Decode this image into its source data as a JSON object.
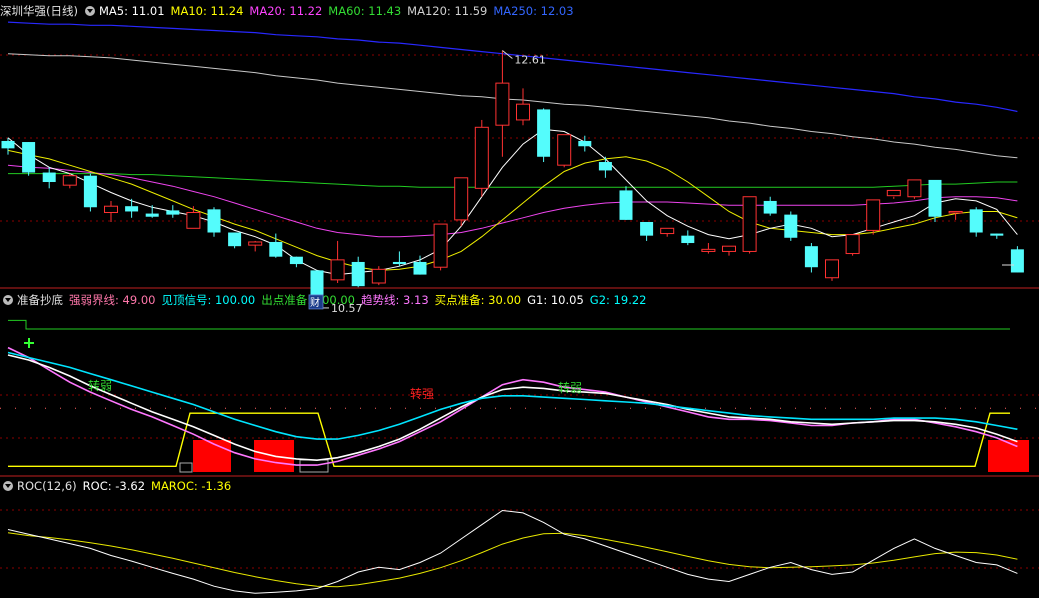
{
  "header1": {
    "title": "深圳华强(日线)",
    "items": [
      {
        "label": "MA5: 11.01",
        "color": "#ffffff"
      },
      {
        "label": "MA10: 11.24",
        "color": "#ffff00"
      },
      {
        "label": "MA20: 11.22",
        "color": "#ff44ff"
      },
      {
        "label": "MA60: 11.43",
        "color": "#33dd33"
      },
      {
        "label": "MA120: 11.59",
        "color": "#d0d0d0"
      },
      {
        "label": "MA250: 12.03",
        "color": "#3366ff"
      }
    ]
  },
  "header2": {
    "title": "准备抄底",
    "items": [
      {
        "label": "强弱界线: 49.00",
        "color": "#ff77aa"
      },
      {
        "label": "见顶信号: 100.00",
        "color": "#00ffff"
      },
      {
        "label": "出点准备: 100.00",
        "color": "#33dd33"
      },
      {
        "label": "趋势线: 3.13",
        "color": "#ff77ff"
      },
      {
        "label": "买点准备: 30.00",
        "color": "#ffff00"
      },
      {
        "label": "G1: 10.05",
        "color": "#ffffff"
      },
      {
        "label": "G2: 19.22",
        "color": "#00ffff"
      }
    ]
  },
  "header3": {
    "title": "ROC(12,6)",
    "items": [
      {
        "label": "ROC: -3.62",
        "color": "#ffffff"
      },
      {
        "label": "MAROC: -1.36",
        "color": "#ffff00"
      }
    ]
  },
  "annotations": {
    "high": "12.61",
    "low": "10.57",
    "cai": "财",
    "weak1": "转弱",
    "strong": "转强",
    "weak2": "转弱"
  },
  "colors": {
    "up": "#ff3232",
    "down": "#54fcfc",
    "bg": "#000000",
    "grid": "#8b0000"
  },
  "chart_data": [
    {
      "type": "candlestick",
      "title": "深圳华强(日线)",
      "ylim": [
        10.4,
        12.9
      ],
      "candles": [
        [
          11.75,
          11.78,
          11.68,
          11.62
        ],
        [
          11.74,
          11.74,
          11.45,
          11.42
        ],
        [
          11.45,
          11.5,
          11.36,
          11.3
        ],
        [
          11.33,
          11.44,
          11.42,
          11.3
        ],
        [
          11.42,
          11.44,
          11.12,
          11.08
        ],
        [
          11.07,
          11.18,
          11.13,
          10.98
        ],
        [
          11.13,
          11.2,
          11.08,
          11.02
        ],
        [
          11.06,
          11.14,
          11.03,
          11.02
        ],
        [
          11.09,
          11.14,
          11.05,
          11.02
        ],
        [
          10.92,
          11.13,
          11.07,
          10.92
        ],
        [
          11.1,
          11.12,
          10.88,
          10.84
        ],
        [
          10.88,
          10.88,
          10.75,
          10.73
        ],
        [
          10.76,
          10.8,
          10.79,
          10.7
        ],
        [
          10.79,
          10.87,
          10.65,
          10.64
        ],
        [
          10.65,
          10.65,
          10.58,
          10.55
        ],
        [
          10.52,
          10.52,
          10.26,
          10.22
        ],
        [
          10.43,
          10.8,
          10.62,
          10.4
        ],
        [
          10.6,
          10.65,
          10.37,
          10.36
        ],
        [
          10.4,
          10.56,
          10.53,
          10.38
        ],
        [
          10.6,
          10.7,
          10.58,
          10.56
        ],
        [
          10.6,
          10.66,
          10.48,
          10.48
        ],
        [
          10.55,
          10.95,
          10.96,
          10.52
        ],
        [
          11.0,
          11.2,
          11.4,
          10.94
        ],
        [
          11.3,
          11.95,
          11.88,
          11.22
        ],
        [
          11.9,
          12.61,
          12.3,
          11.6
        ],
        [
          11.95,
          12.25,
          12.1,
          11.9
        ],
        [
          12.05,
          12.06,
          11.6,
          11.55
        ],
        [
          11.52,
          11.75,
          11.81,
          11.5
        ],
        [
          11.75,
          11.8,
          11.7,
          11.65
        ],
        [
          11.55,
          11.6,
          11.47,
          11.4
        ],
        [
          11.28,
          11.32,
          11.0,
          11.0
        ],
        [
          10.98,
          10.95,
          10.85,
          10.8
        ],
        [
          10.87,
          10.9,
          10.92,
          10.84
        ],
        [
          10.85,
          10.9,
          10.78,
          10.76
        ],
        [
          10.7,
          10.78,
          10.72,
          10.68
        ],
        [
          10.7,
          10.71,
          10.75,
          10.66
        ],
        [
          10.7,
          11.12,
          11.22,
          10.68
        ],
        [
          11.18,
          11.22,
          11.06,
          11.04
        ],
        [
          11.05,
          11.08,
          10.83,
          10.8
        ],
        [
          10.75,
          10.78,
          10.55,
          10.5
        ],
        [
          10.45,
          10.6,
          10.62,
          10.42
        ],
        [
          10.68,
          10.73,
          10.86,
          10.66
        ],
        [
          10.9,
          11.1,
          11.19,
          10.86
        ],
        [
          11.23,
          11.22,
          11.28,
          11.2
        ],
        [
          11.22,
          11.37,
          11.38,
          11.2
        ],
        [
          11.38,
          11.35,
          11.03,
          10.98
        ],
        [
          11.07,
          11.07,
          11.08,
          11.0
        ],
        [
          11.1,
          11.12,
          10.88,
          10.84
        ],
        [
          10.87,
          10.87,
          10.85,
          10.82
        ],
        [
          10.72,
          10.75,
          10.5,
          10.5
        ]
      ],
      "ma5": [
        11.78,
        11.62,
        11.5,
        11.44,
        11.35,
        11.26,
        11.18,
        11.12,
        11.08,
        11.04,
        10.98,
        10.9,
        10.84,
        10.76,
        10.62,
        10.52,
        10.48,
        10.5,
        10.52,
        10.56,
        10.62,
        10.72,
        10.94,
        11.22,
        11.5,
        11.72,
        11.86,
        11.84,
        11.74,
        11.58,
        11.38,
        11.18,
        11.04,
        10.94,
        10.86,
        10.82,
        10.86,
        10.92,
        10.96,
        10.92,
        10.84,
        10.86,
        10.92,
        10.98,
        11.04,
        11.16,
        11.2,
        11.18,
        11.1,
        10.86
      ],
      "ma10": [
        11.66,
        11.62,
        11.58,
        11.52,
        11.46,
        11.4,
        11.34,
        11.26,
        11.18,
        11.1,
        11.03,
        10.96,
        10.9,
        10.82,
        10.74,
        10.66,
        10.6,
        10.55,
        10.52,
        10.53,
        10.56,
        10.62,
        10.7,
        10.84,
        11.0,
        11.16,
        11.32,
        11.46,
        11.54,
        11.58,
        11.6,
        11.56,
        11.48,
        11.36,
        11.22,
        11.08,
        10.98,
        10.92,
        10.9,
        10.88,
        10.86,
        10.86,
        10.88,
        10.92,
        10.96,
        11.02,
        11.06,
        11.08,
        11.08,
        11.02
      ],
      "ma20": [
        11.52,
        11.5,
        11.49,
        11.47,
        11.45,
        11.43,
        11.4,
        11.36,
        11.32,
        11.27,
        11.22,
        11.16,
        11.1,
        11.04,
        10.98,
        10.92,
        10.88,
        10.86,
        10.84,
        10.84,
        10.85,
        10.86,
        10.88,
        10.92,
        10.97,
        11.02,
        11.07,
        11.11,
        11.14,
        11.16,
        11.17,
        11.17,
        11.17,
        11.16,
        11.15,
        11.14,
        11.14,
        11.14,
        11.14,
        11.14,
        11.14,
        11.14,
        11.15,
        11.16,
        11.18,
        11.21,
        11.22,
        11.22,
        11.21,
        11.18
      ],
      "ma60": [
        11.44,
        11.44,
        11.44,
        11.44,
        11.44,
        11.44,
        11.43,
        11.43,
        11.42,
        11.41,
        11.4,
        11.39,
        11.38,
        11.37,
        11.36,
        11.35,
        11.34,
        11.33,
        11.32,
        11.32,
        11.31,
        11.31,
        11.31,
        11.31,
        11.31,
        11.31,
        11.31,
        11.31,
        11.31,
        11.31,
        11.31,
        11.31,
        11.31,
        11.31,
        11.31,
        11.31,
        11.31,
        11.31,
        11.31,
        11.31,
        11.31,
        11.31,
        11.31,
        11.32,
        11.33,
        11.34,
        11.34,
        11.35,
        11.36,
        11.36
      ],
      "ma120": [
        12.58,
        12.57,
        12.56,
        12.56,
        12.55,
        12.54,
        12.52,
        12.5,
        12.48,
        12.46,
        12.44,
        12.42,
        12.4,
        12.37,
        12.35,
        12.33,
        12.3,
        12.28,
        12.26,
        12.24,
        12.22,
        12.2,
        12.18,
        12.17,
        12.15,
        12.14,
        12.12,
        12.1,
        12.09,
        12.07,
        12.05,
        12.03,
        12.01,
        11.99,
        11.97,
        11.94,
        11.92,
        11.89,
        11.87,
        11.84,
        11.82,
        11.79,
        11.77,
        11.74,
        11.72,
        11.69,
        11.67,
        11.64,
        11.61,
        11.59
      ],
      "ma250": [
        12.88,
        12.87,
        12.86,
        12.86,
        12.85,
        12.85,
        12.84,
        12.83,
        12.82,
        12.81,
        12.8,
        12.79,
        12.78,
        12.76,
        12.75,
        12.74,
        12.72,
        12.71,
        12.69,
        12.68,
        12.66,
        12.64,
        12.62,
        12.6,
        12.58,
        12.56,
        12.54,
        12.52,
        12.5,
        12.48,
        12.46,
        12.44,
        12.42,
        12.4,
        12.38,
        12.36,
        12.34,
        12.32,
        12.3,
        12.28,
        12.26,
        12.24,
        12.22,
        12.2,
        12.17,
        12.15,
        12.12,
        12.1,
        12.07,
        12.03
      ]
    },
    {
      "type": "line",
      "title": "准备抄底",
      "ylim": [
        -5,
        130
      ],
      "reference_lines": {
        "强弱界线": 49,
        "见顶信号": 100,
        "出点准备": 100
      },
      "series": [
        {
          "name": "趋势线",
          "values": [
            98,
            90,
            80,
            70,
            62,
            55,
            48,
            42,
            35,
            28,
            20,
            13,
            8,
            5,
            3,
            3,
            6,
            11,
            16,
            22,
            30,
            38,
            48,
            58,
            68,
            72,
            70,
            66,
            64,
            62,
            58,
            54,
            50,
            46,
            42,
            40,
            40,
            39,
            37,
            35,
            35,
            37,
            38,
            40,
            40,
            37,
            34,
            30,
            25,
            18
          ]
        },
        {
          "name": "G1",
          "values": [
            92,
            88,
            82,
            75,
            67,
            60,
            53,
            46,
            40,
            34,
            27,
            20,
            14,
            10,
            8,
            7,
            9,
            13,
            18,
            24,
            32,
            41,
            50,
            58,
            64,
            66,
            65,
            63,
            62,
            61,
            58,
            55,
            52,
            48,
            45,
            42,
            41,
            40,
            38,
            37,
            36,
            37,
            38,
            39,
            39,
            38,
            36,
            33,
            28,
            22
          ]
        },
        {
          "name": "G2",
          "values": [
            94,
            90,
            86,
            82,
            77,
            72,
            67,
            62,
            57,
            52,
            46,
            40,
            35,
            30,
            26,
            24,
            24,
            27,
            31,
            36,
            42,
            48,
            53,
            57,
            59,
            59,
            58,
            57,
            56,
            55,
            54,
            53,
            51,
            49,
            47,
            45,
            43,
            42,
            41,
            40,
            40,
            40,
            40,
            41,
            41,
            41,
            40,
            38,
            35,
            32
          ]
        },
        {
          "name": "买点准备",
          "values": [
            2,
            2,
            2,
            2,
            2,
            2,
            2,
            2,
            2,
            2,
            2,
            2,
            2,
            2,
            2,
            2,
            2,
            2,
            2,
            2,
            2,
            2,
            2,
            2,
            2,
            2,
            2,
            2,
            2,
            2,
            2,
            2,
            2,
            2,
            2,
            2,
            2,
            2,
            2,
            2,
            2,
            2,
            2,
            2,
            2,
            2,
            2,
            2,
            2,
            2
          ]
        }
      ]
    },
    {
      "type": "line",
      "title": "ROC(12,6)",
      "ylim": [
        -12,
        10
      ],
      "series": [
        {
          "name": "ROC",
          "values": [
            2.5,
            1.5,
            0.5,
            -0.5,
            -1.5,
            -3.0,
            -4.2,
            -5.5,
            -6.8,
            -8.0,
            -9.5,
            -10.5,
            -11,
            -10.8,
            -10.5,
            -10,
            -8.5,
            -6.5,
            -5.5,
            -6.0,
            -4.5,
            -2.5,
            0.5,
            3.5,
            6.5,
            6.0,
            4.0,
            1.5,
            0.5,
            -1.0,
            -2.5,
            -4.0,
            -5.5,
            -7.0,
            -8.0,
            -8.5,
            -7.0,
            -5.5,
            -4.5,
            -6.0,
            -7.0,
            -6.5,
            -4.0,
            -1.5,
            0.5,
            -1.5,
            -3.0,
            -4.5,
            -5.0,
            -6.8
          ]
        },
        {
          "name": "MAROC",
          "values": [
            1.8,
            1.2,
            0.8,
            0.3,
            -0.3,
            -1.0,
            -1.8,
            -2.7,
            -3.6,
            -4.6,
            -5.6,
            -6.6,
            -7.5,
            -8.3,
            -9.0,
            -9.5,
            -9.6,
            -9.2,
            -8.5,
            -7.8,
            -6.8,
            -5.6,
            -4.1,
            -2.4,
            -0.6,
            0.7,
            1.6,
            1.7,
            1.2,
            0.4,
            -0.4,
            -1.3,
            -2.2,
            -3.2,
            -4.1,
            -4.9,
            -5.4,
            -5.6,
            -5.5,
            -5.4,
            -5.2,
            -5.0,
            -4.6,
            -4.0,
            -3.3,
            -2.6,
            -2.3,
            -2.4,
            -2.9,
            -3.8
          ]
        }
      ]
    }
  ]
}
